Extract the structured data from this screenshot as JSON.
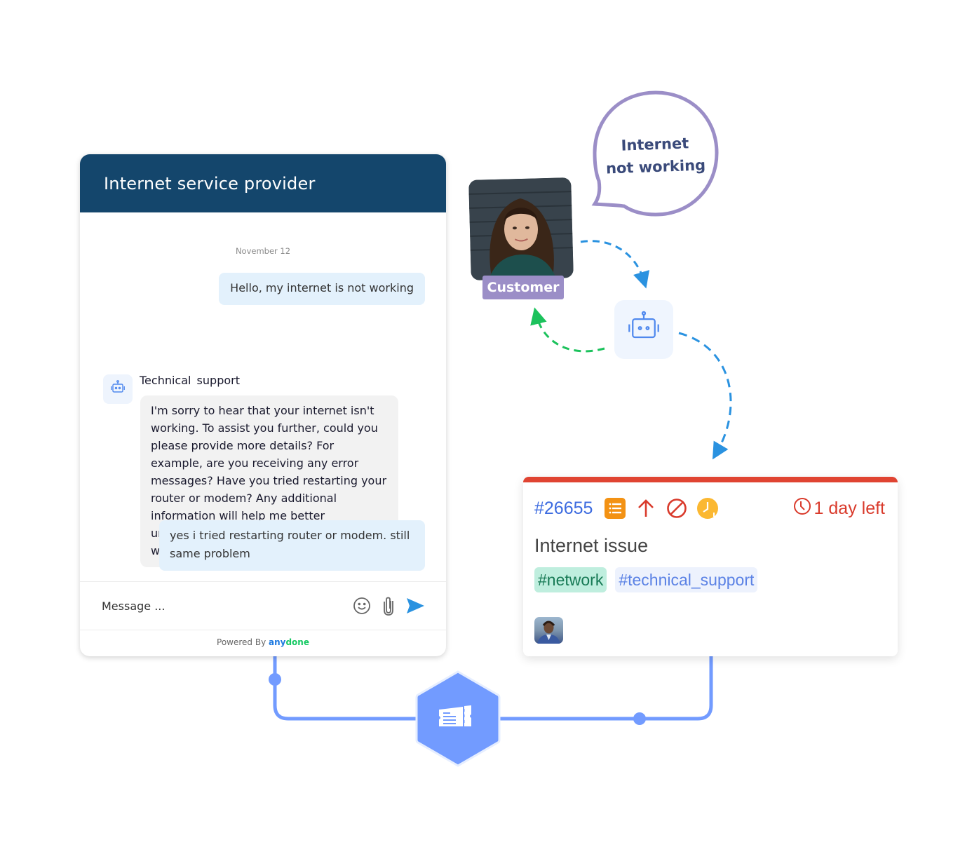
{
  "chat": {
    "title": "Internet service provider",
    "date": "November 12",
    "messages": [
      {
        "sender": "user",
        "text": "Hello, my internet is not working"
      },
      {
        "sender": "bot",
        "name": "Technical  support",
        "avatar_icon": "robot-icon",
        "text": "I'm sorry to hear that your internet isn't working. To assist you further, could you please provide more details?  For example, are you receiving any error messages? Have you tried restarting your router or modem? Any additional information will help me better understand the issue and provide you with the right solution."
      },
      {
        "sender": "user",
        "text": "yes i tried restarting router or modem. still same problem"
      }
    ],
    "composer": {
      "placeholder": "Message ...",
      "icons": [
        "emoji-icon",
        "attachment-icon",
        "send-icon"
      ]
    },
    "footer": {
      "prefix": "Powered By ",
      "brand_part1": "any",
      "brand_part2": "done"
    }
  },
  "customer": {
    "label": "Customer",
    "speech_line1": "Internet",
    "speech_line2": "not working"
  },
  "ticket": {
    "id": "#26655",
    "status_icons": [
      "list-icon",
      "arrow-up-icon",
      "blocked-icon",
      "clock-alert-icon"
    ],
    "due": "1 day left",
    "title": "Internet issue",
    "tags": [
      "#network",
      "#technical_support"
    ],
    "accent_color": "#e04432"
  },
  "colors": {
    "chat_header": "#14466c",
    "user_bubble": "#e3f1fc",
    "bot_bubble": "#f2f2f2",
    "flow_line": "#729bff",
    "arrow_blue": "#2a92e0",
    "arrow_green": "#1cc25c",
    "speech_border": "#9b8ec7"
  }
}
